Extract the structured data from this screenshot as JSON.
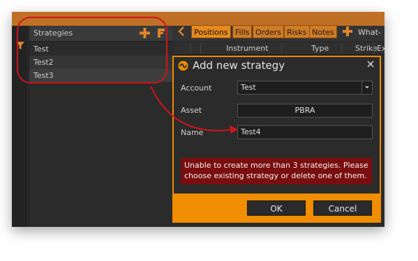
{
  "left_panel": {
    "title": "Strategies",
    "items": [
      {
        "label": "Test"
      },
      {
        "label": "Test2"
      },
      {
        "label": "Test3"
      }
    ]
  },
  "tabs": [
    {
      "label": "Positions"
    },
    {
      "label": "Fills"
    },
    {
      "label": "Orders"
    },
    {
      "label": "Risks"
    },
    {
      "label": "Notes"
    }
  ],
  "whatif_label": "What-if",
  "grid_headers": {
    "instrument": "Instrument",
    "type": "Type",
    "strike": "Strike",
    "ex": "Ex"
  },
  "dialog": {
    "title": "Add new strategy",
    "account_label": "Account",
    "account_value": "Test",
    "asset_label": "Asset",
    "asset_value": "PBRA",
    "name_label": "Name",
    "name_value": "Test4",
    "error": "Unable to create more than 3 strategies. Please choose existing strategy or delete one of them.",
    "ok": "OK",
    "cancel": "Cancel"
  },
  "colors": {
    "accent": "#f08d00",
    "error_bg": "#7a0e0e",
    "highlight": "#d1141a"
  }
}
